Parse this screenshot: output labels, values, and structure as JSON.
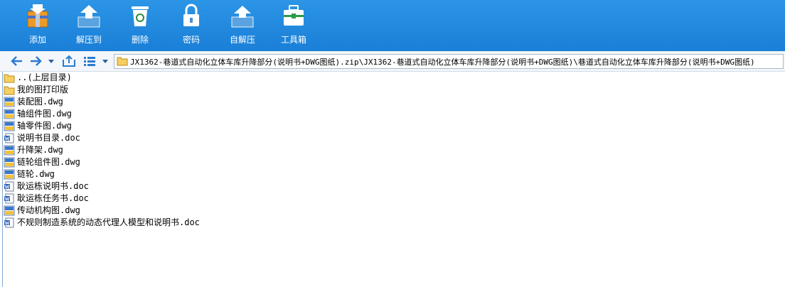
{
  "toolbar": {
    "buttons": [
      {
        "label": "添加",
        "icon": "add-archive-icon"
      },
      {
        "label": "解压到",
        "icon": "extract-to-icon"
      },
      {
        "label": "删除",
        "icon": "delete-icon"
      },
      {
        "label": "密码",
        "icon": "password-lock-icon"
      },
      {
        "label": "自解压",
        "icon": "self-extract-icon"
      },
      {
        "label": "工具箱",
        "icon": "toolbox-icon"
      }
    ]
  },
  "address": {
    "path": "JX1362-巷道式自动化立体车库升降部分(说明书+DWG图纸).zip\\JX1362-巷道式自动化立体车库升降部分(说明书+DWG图纸)\\巷道式自动化立体车库升降部分(说明书+DWG图纸)"
  },
  "files": [
    {
      "name": "..(上层目录)",
      "type": "folder"
    },
    {
      "name": "我的图打印版",
      "type": "folder"
    },
    {
      "name": "装配图.dwg",
      "type": "dwg"
    },
    {
      "name": "轴组件图.dwg",
      "type": "dwg"
    },
    {
      "name": "轴零件图.dwg",
      "type": "dwg"
    },
    {
      "name": "说明书目录.doc",
      "type": "doc"
    },
    {
      "name": "升降架.dwg",
      "type": "dwg"
    },
    {
      "name": "链轮组件图.dwg",
      "type": "dwg"
    },
    {
      "name": "链轮.dwg",
      "type": "dwg"
    },
    {
      "name": "耿运栋说明书.doc",
      "type": "doc"
    },
    {
      "name": "耿运栋任务书.doc",
      "type": "doc"
    },
    {
      "name": "传动机构图.dwg",
      "type": "dwg"
    },
    {
      "name": "不规则制造系统的动态代理人模型和说明书.doc",
      "type": "doc"
    }
  ]
}
